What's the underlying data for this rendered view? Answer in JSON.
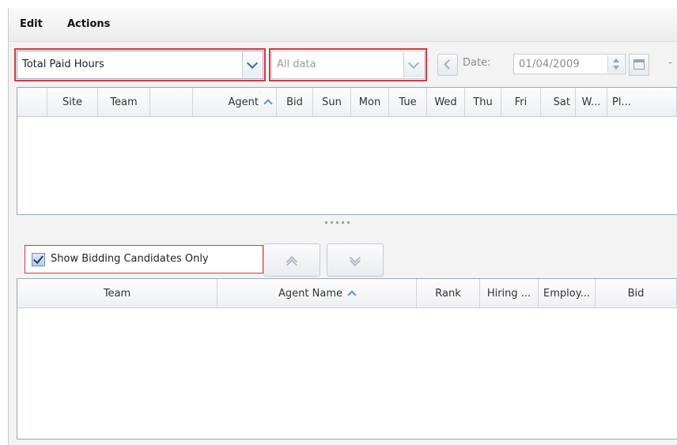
{
  "menu": {
    "edit": "Edit",
    "actions": "Actions"
  },
  "toolbar": {
    "measure_select": {
      "value": "Total Paid Hours"
    },
    "filter_select": {
      "value": "All data"
    },
    "date_label": "Date:",
    "date_value": "01/04/2009",
    "trailing": "-"
  },
  "top_grid": {
    "columns": [
      "",
      "Site",
      "Team",
      "",
      "Agent",
      "Bid",
      "Sun",
      "Mon",
      "Tue",
      "Wed",
      "Thu",
      "Fri",
      "Sat",
      "W...",
      "Pl..."
    ]
  },
  "bidding": {
    "checkbox_label": "Show Bidding Candidates Only",
    "checked": true
  },
  "bottom_grid": {
    "columns": [
      "Team",
      "Agent Name",
      "Rank",
      "Hiring ...",
      "Employ...",
      "Bid"
    ]
  },
  "colors": {
    "highlight": "#d8383f",
    "accent": "#3d6ea8"
  }
}
